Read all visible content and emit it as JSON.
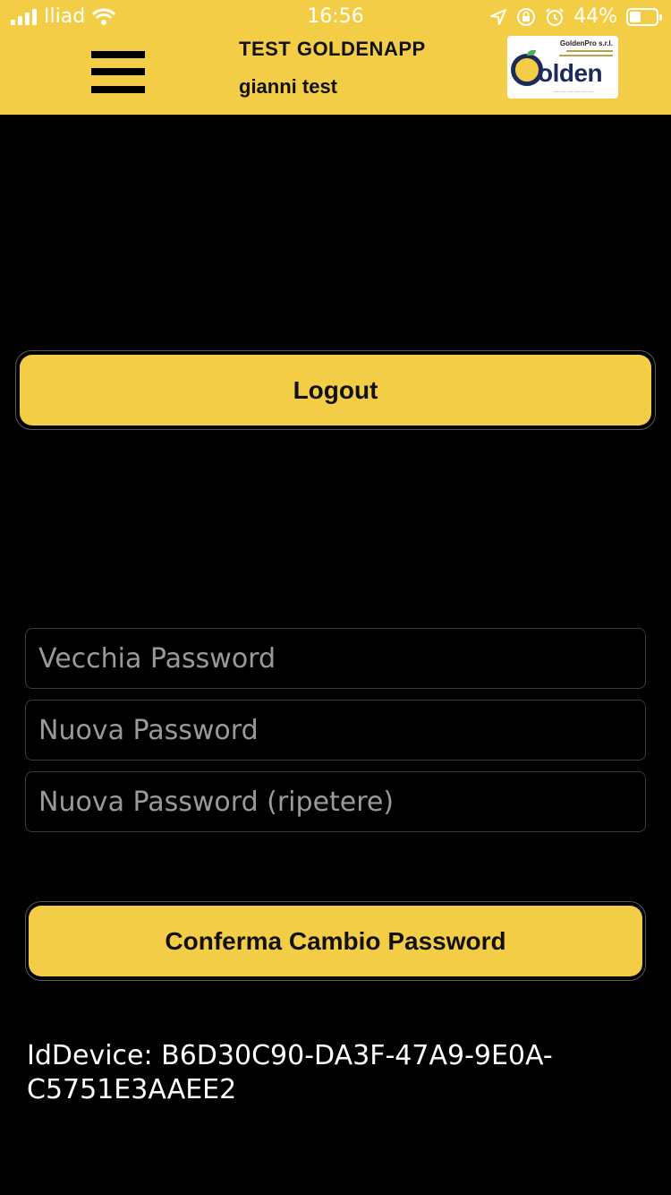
{
  "status_bar": {
    "carrier": "Iliad",
    "time": "16:56",
    "battery_percent": "44%",
    "battery_level": 0.44,
    "icons": [
      "signal-icon",
      "wifi-icon",
      "location-icon",
      "orientation-lock-icon",
      "alarm-icon",
      "battery-icon"
    ]
  },
  "header": {
    "app_title": "TEST GOLDENAPP",
    "user_name": "gianni test",
    "menu_icon": "hamburger-menu-icon",
    "logo": {
      "company": "GoldenPro s.r.l.",
      "word": "Golden",
      "brand_color": "#1d2b5a"
    }
  },
  "actions": {
    "logout_label": "Logout",
    "confirm_label": "Conferma Cambio Password"
  },
  "form": {
    "old_password_placeholder": "Vecchia Password",
    "new_password_placeholder": "Nuova Password",
    "repeat_password_placeholder": "Nuova Password (ripetere)"
  },
  "device": {
    "label": "IdDevice: B6D30C90-DA3F-47A9-9E0A-C5751E3AAEE2"
  },
  "colors": {
    "accent": "#F4CD46",
    "background": "#000000",
    "text_on_accent": "#111111"
  }
}
